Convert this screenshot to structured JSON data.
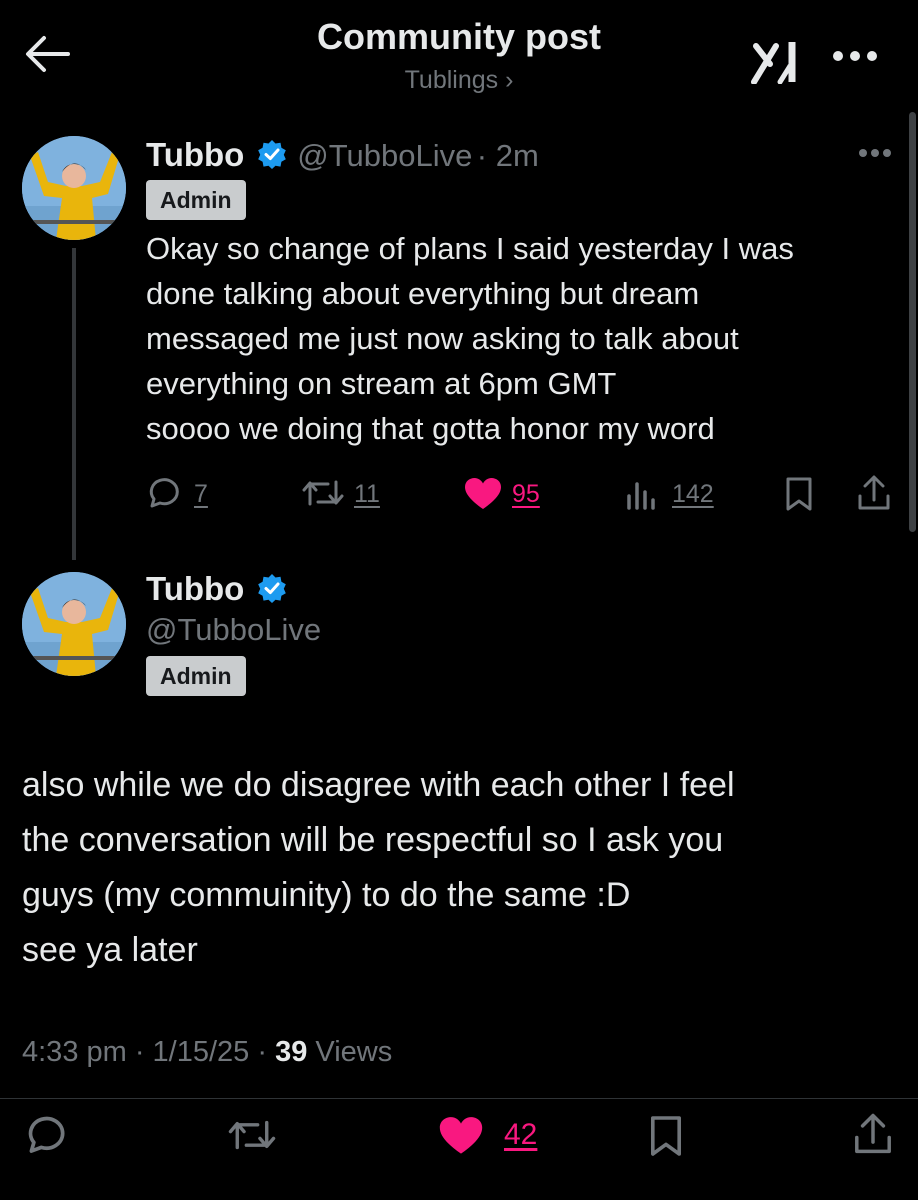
{
  "header": {
    "title": "Community post",
    "community": "Tublings ›"
  },
  "parent_post": {
    "name": "Tubbo",
    "handle": "@TubboLive",
    "time": "· 2m",
    "badge": "Admin",
    "text": "Okay so change of plans I said yesterday I was\ndone talking about everything but dream\nmessaged me just now asking to talk about\neverything on stream at 6pm GMT\nsoooo we doing that gotta honor my word",
    "actions": {
      "replies": "7",
      "reposts": "11",
      "likes": "95",
      "views": "142"
    }
  },
  "main_post": {
    "name": "Tubbo",
    "handle": "@TubboLive",
    "badge": "Admin",
    "text": "also while we do disagree with each other I feel\nthe conversation will be respectful so I ask you\nguys (my commuinity) to do the same :D\nsee ya later",
    "meta_time": "4:33 pm · 1/15/25 · ",
    "meta_views_count": "39",
    "meta_views_label": " Views",
    "actions": {
      "likes": "42"
    }
  },
  "colors": {
    "background": "#000000",
    "text": "#e7e9ea",
    "muted": "#71767b",
    "like_pink": "#f91880",
    "verified_blue": "#1d9bf0",
    "badge_bg": "#c9ccce"
  }
}
